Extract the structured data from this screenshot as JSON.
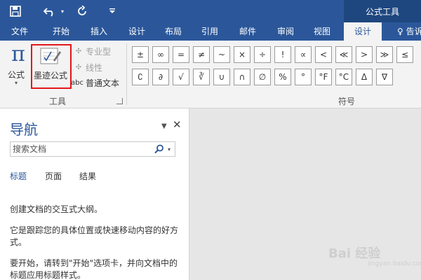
{
  "quick_access": {
    "save_icon": "save-icon",
    "undo_icon": "undo-icon",
    "repeat_icon": "repeat-icon",
    "customize_icon": "customize-qat-icon"
  },
  "context_title": "公式工具",
  "tabs": [
    "文件",
    "开始",
    "插入",
    "设计",
    "布局",
    "引用",
    "邮件",
    "审阅",
    "视图",
    "设计"
  ],
  "active_tab_index": 9,
  "help_text": "♀ 告诉",
  "ribbon": {
    "formula_label": "公式",
    "ink_formula_label": "墨迹公式",
    "professional_label": "专业型",
    "linear_label": "线性",
    "normal_text_label": "普通文本",
    "normal_text_icon": "abc",
    "tools_group_label": "工具",
    "symbols_group_label": "符号",
    "symbols_row1": [
      "±",
      "∞",
      "=",
      "≠",
      "~",
      "×",
      "÷",
      "!",
      "∝",
      "<",
      "≪",
      ">",
      "≫",
      "≤"
    ],
    "symbols_row2": [
      "∁",
      "∂",
      "√",
      "∛",
      "∪",
      "∩",
      "∅",
      "%",
      "°",
      "°F",
      "°C",
      "Δ",
      "∇"
    ]
  },
  "nav": {
    "title": "导航",
    "search_placeholder": "搜索文档",
    "tabs": [
      "标题",
      "页面",
      "结果"
    ],
    "active_tab_index": 0,
    "para1": "创建文档的交互式大纲。",
    "para2": "它是跟踪您的具体位置或快速移动内容的好方式。",
    "para3": "要开始，请转到\"开始\"选项卡，并向文档中的标题应用标题样式。"
  },
  "watermark": {
    "text": "Bai 经验",
    "sub": "jingyan.baidu.com"
  },
  "colors": {
    "brand": "#2b579a",
    "highlight": "#e3151a"
  }
}
